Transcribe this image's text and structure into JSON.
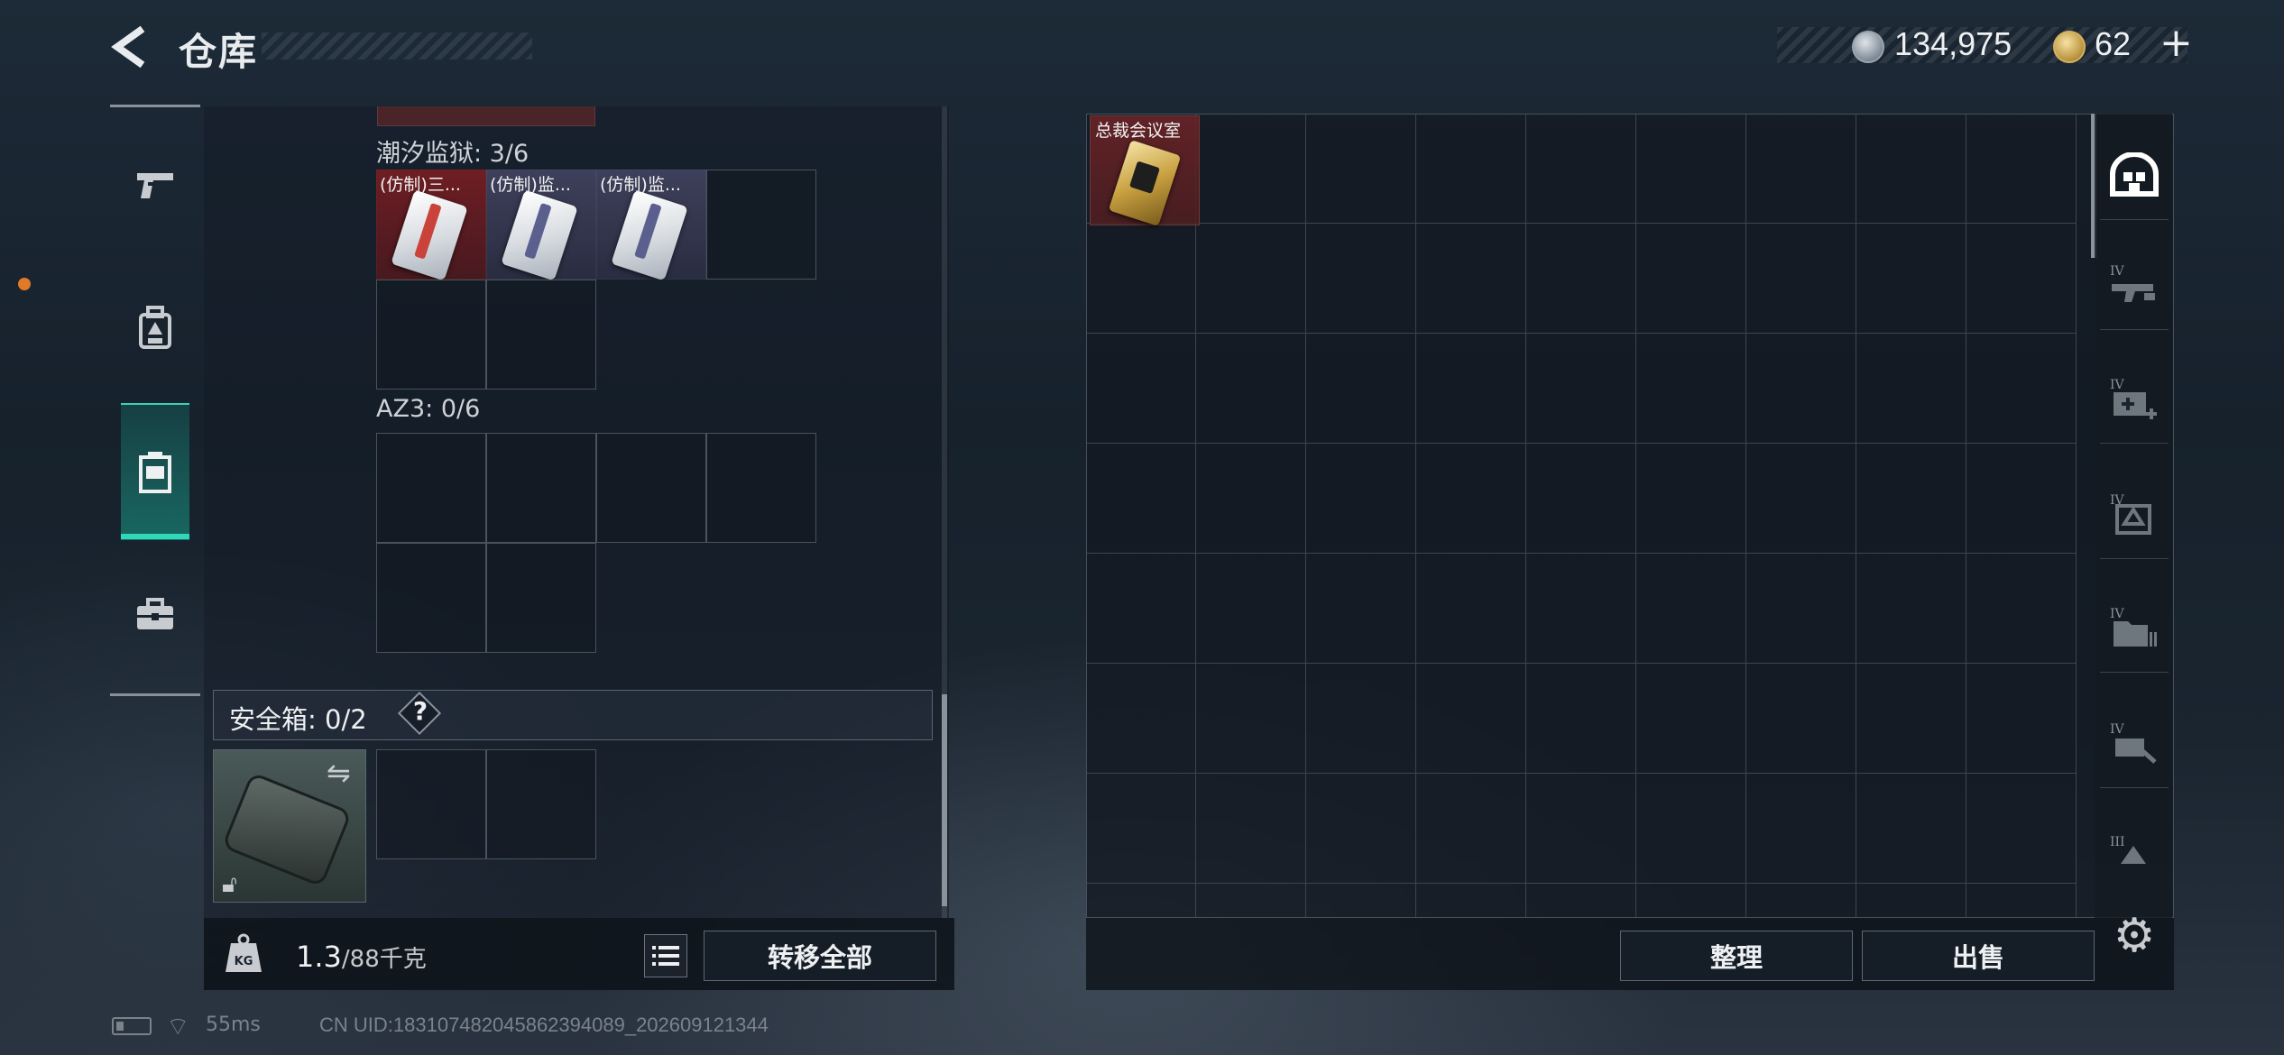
{
  "header": {
    "title": "仓库",
    "currency_silver": "134,975",
    "currency_gold": "62",
    "plus_label": "+"
  },
  "left_panel": {
    "section1_label": "潮汐监狱: 3/6",
    "section1_items": [
      {
        "name": "(仿制)三...",
        "rarity": "red"
      },
      {
        "name": "(仿制)监...",
        "rarity": "blue"
      },
      {
        "name": "(仿制)监...",
        "rarity": "blue"
      }
    ],
    "section2_label": "AZ3: 0/6",
    "safe_box_label": "安全箱: 0/2",
    "help_label": "?",
    "weight_current": "1.3",
    "weight_max": "/88千克",
    "transfer_all_label": "转移全部"
  },
  "right_panel": {
    "item_name": "总裁会议室",
    "sort_label": "整理",
    "sell_label": "出售"
  },
  "status": {
    "ping": "55ms",
    "uid": "CN UID:18310748204586239408​9_202609121344"
  },
  "colors": {
    "accent": "#2fd8b8",
    "red_rarity": "#7a2a2e",
    "blue_rarity": "#3a3e5e",
    "gold_rarity": "#c8a040"
  },
  "icons": {
    "nav": [
      "pistol-icon",
      "backpack-icon",
      "container-icon",
      "toolbox-icon"
    ],
    "rail": [
      "home-icon",
      "tier4-weapon-icon",
      "tier4-medkit-icon",
      "tier4-container-icon",
      "tier4-folder-icon",
      "tier4-tools-icon",
      "tier3-container-icon"
    ]
  }
}
